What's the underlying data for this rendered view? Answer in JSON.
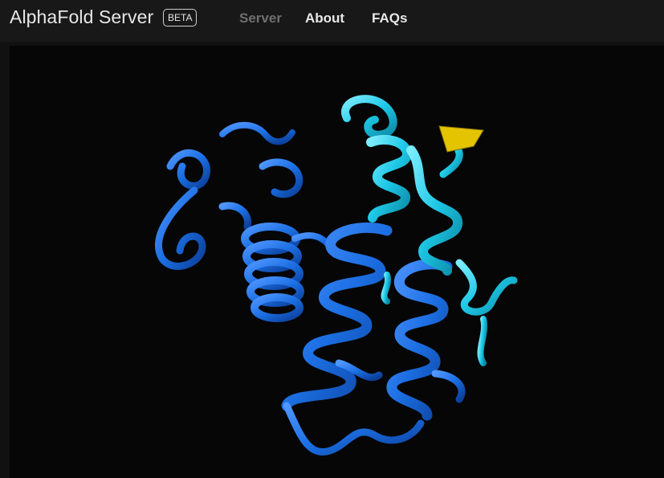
{
  "header": {
    "app_title": "AlphaFold Server",
    "badge": "BETA",
    "nav": [
      {
        "label": "Server",
        "active": true
      },
      {
        "label": "About",
        "active": false
      },
      {
        "label": "FAQs",
        "active": false
      }
    ]
  },
  "viewer": {
    "content": "protein-structure-ribbon",
    "colors": {
      "very_high_confidence": "#1c6fe3",
      "high_confidence": "#1ec8e6",
      "low_confidence": "#e4c400",
      "background": "#060606"
    }
  }
}
